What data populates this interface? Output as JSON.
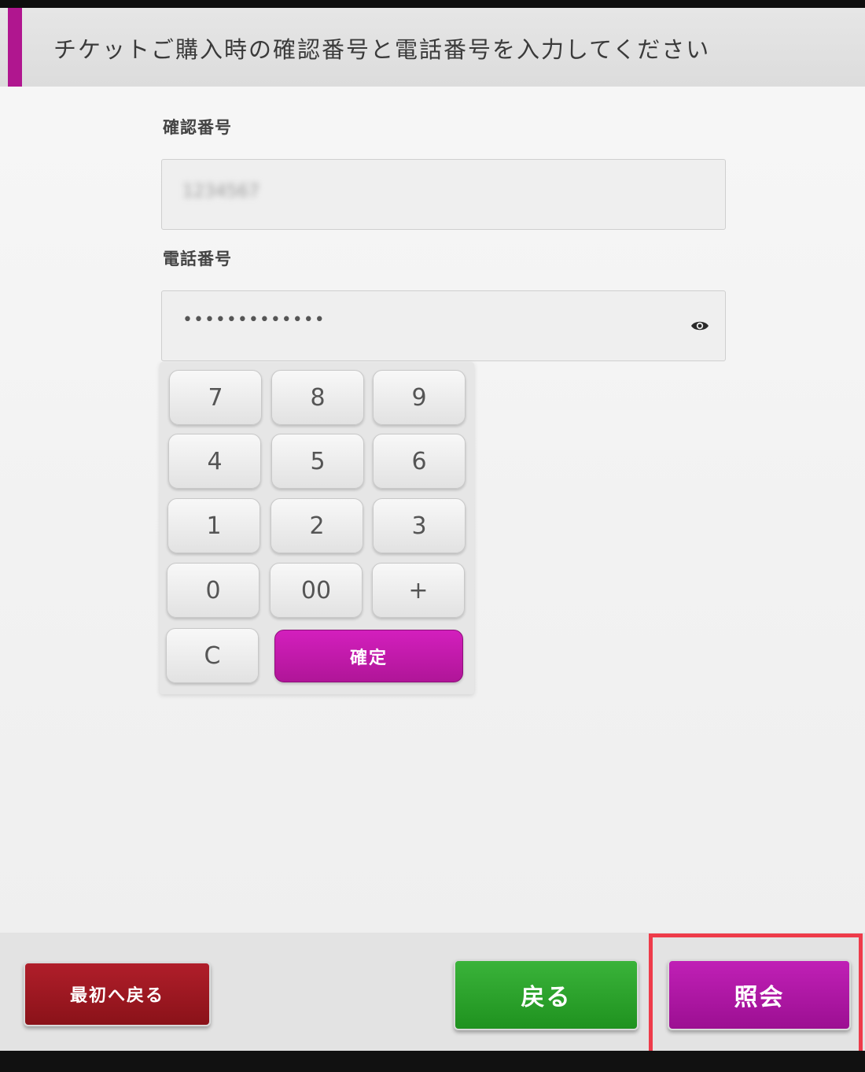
{
  "header": {
    "title": "チケットご購入時の確認番号と電話番号を入力してください"
  },
  "confirmation_field": {
    "label": "確認番号",
    "value": "1234567"
  },
  "phone_field": {
    "label": "電話番号",
    "value": "•••••••••••••",
    "toggle_icon": "eye-icon"
  },
  "keypad": {
    "keys": [
      "7",
      "8",
      "9",
      "4",
      "5",
      "6",
      "1",
      "2",
      "3",
      "0",
      "00",
      "+",
      "C"
    ],
    "confirm_label": "確定",
    "confirm_color": "#c01aa8"
  },
  "footer": {
    "start_label": "最初へ戻る",
    "back_label": "戻る",
    "inquiry_label": "照会"
  },
  "colors": {
    "accent": "#b0168f",
    "start_button": "#9c1822",
    "back_button": "#2aa42a",
    "inquiry_button": "#ad16a4",
    "highlight": "#ee3b4a"
  }
}
